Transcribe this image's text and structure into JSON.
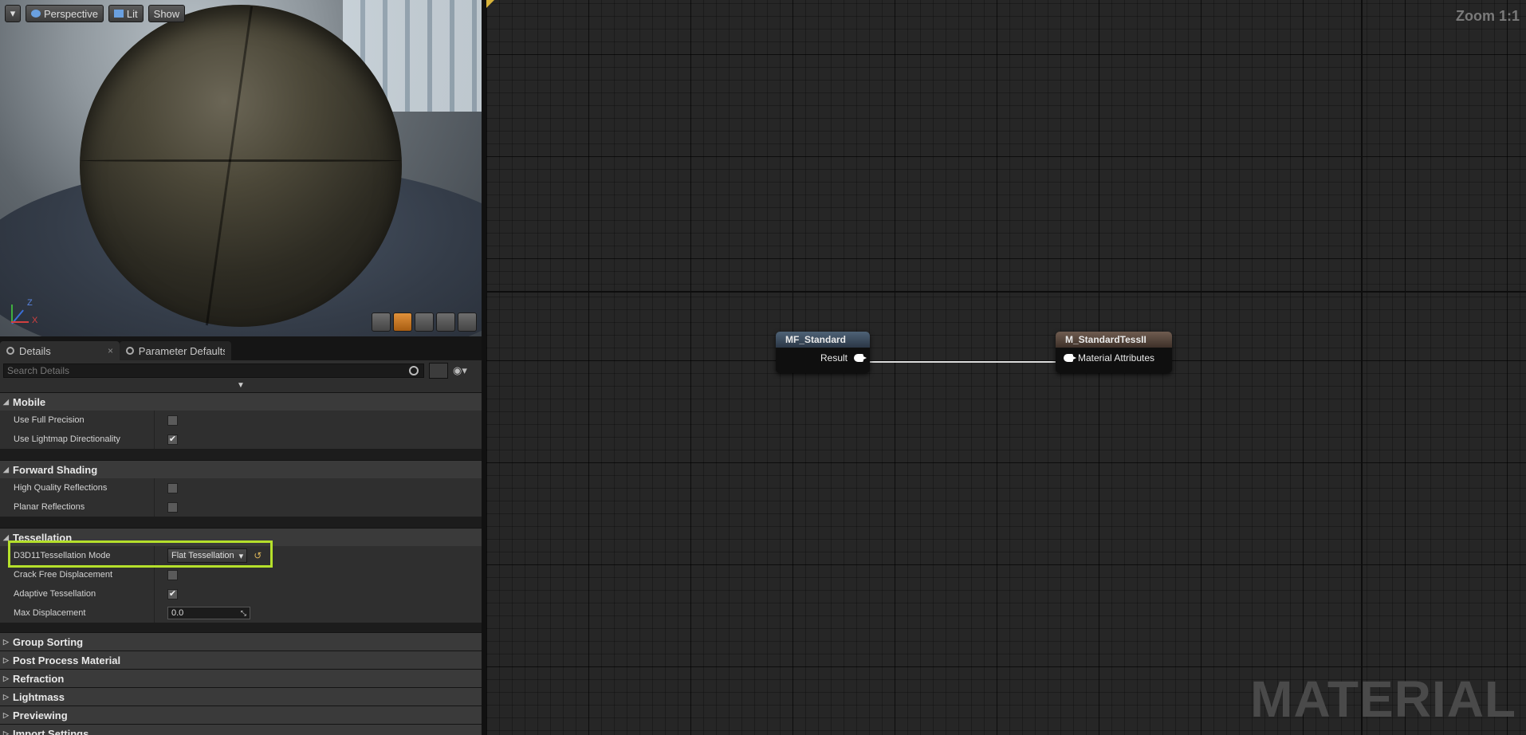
{
  "viewport": {
    "toolbar": {
      "perspective_label": "Perspective",
      "lit_label": "Lit",
      "show_label": "Show"
    },
    "axis": {
      "z_label": "Z",
      "x_label": "X"
    },
    "icons": [
      "cylinder-icon",
      "sphere-icon",
      "plane-icon",
      "cube-icon",
      "teapot-icon"
    ]
  },
  "details": {
    "tabs": [
      {
        "label": "Details",
        "active": true
      },
      {
        "label": "Parameter Defaults",
        "active": false
      }
    ],
    "search_placeholder": "Search Details",
    "sections": {
      "mobile": {
        "title": "Mobile",
        "rows": [
          {
            "label": "Use Full Precision",
            "checked": false
          },
          {
            "label": "Use Lightmap Directionality",
            "checked": true
          }
        ]
      },
      "forward": {
        "title": "Forward Shading",
        "rows": [
          {
            "label": "High Quality Reflections",
            "checked": false
          },
          {
            "label": "Planar Reflections",
            "checked": false
          }
        ]
      },
      "tessellation": {
        "title": "Tessellation",
        "mode_label": "D3D11Tessellation Mode",
        "mode_value": "Flat Tessellation",
        "crack_label": "Crack Free Displacement",
        "crack_checked": false,
        "adaptive_label": "Adaptive Tessellation",
        "adaptive_checked": true,
        "max_disp_label": "Max Displacement",
        "max_disp_value": "0.0"
      },
      "collapsed": [
        "Group Sorting",
        "Post Process Material",
        "Refraction",
        "Lightmass",
        "Previewing",
        "Import Settings"
      ]
    }
  },
  "graph": {
    "zoom_label": "Zoom 1:1",
    "watermark": "MATERIAL",
    "nodes": {
      "mf_standard": {
        "title": "MF_Standard",
        "pin": "Result"
      },
      "m_standard": {
        "title": "M_StandardTessII",
        "pin": "Material Attributes"
      }
    }
  },
  "colors": {
    "highlight": "#b5e02b",
    "mf_header": "#3d4f63",
    "m_header": "#5a4a40"
  }
}
